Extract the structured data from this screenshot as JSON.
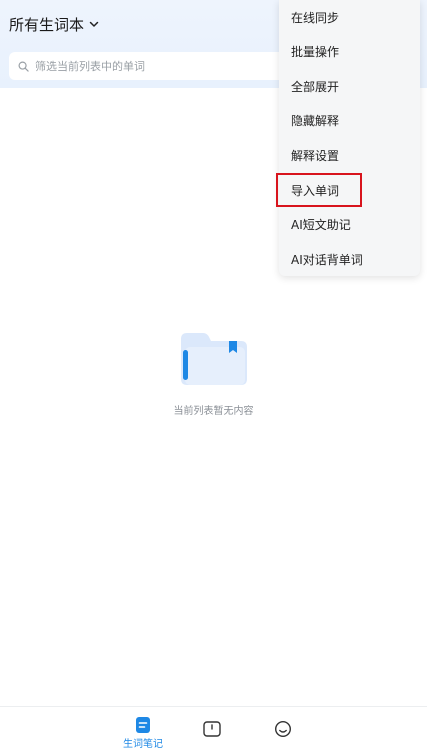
{
  "header": {
    "title": "所有生词本"
  },
  "search": {
    "placeholder": "筛选当前列表中的单词"
  },
  "menu": {
    "items": [
      {
        "label": "在线同步"
      },
      {
        "label": "批量操作"
      },
      {
        "label": "全部展开"
      },
      {
        "label": "隐藏解释"
      },
      {
        "label": "解释设置"
      },
      {
        "label": "导入单词",
        "highlighted": true
      },
      {
        "label": "AI短文助记"
      },
      {
        "label": "AI对话背单词"
      }
    ]
  },
  "empty_state": {
    "text": "当前列表暂无内容"
  },
  "bottom_nav": {
    "items": [
      {
        "icon": "wordbook-icon",
        "label": "生词笔记",
        "active": true
      },
      {
        "icon": "card-icon",
        "label": ""
      },
      {
        "icon": "smiley-icon",
        "label": ""
      }
    ]
  },
  "colors": {
    "accent": "#1e88e5",
    "highlight_border": "#d8141d",
    "header_bg": "#eef4fd"
  }
}
